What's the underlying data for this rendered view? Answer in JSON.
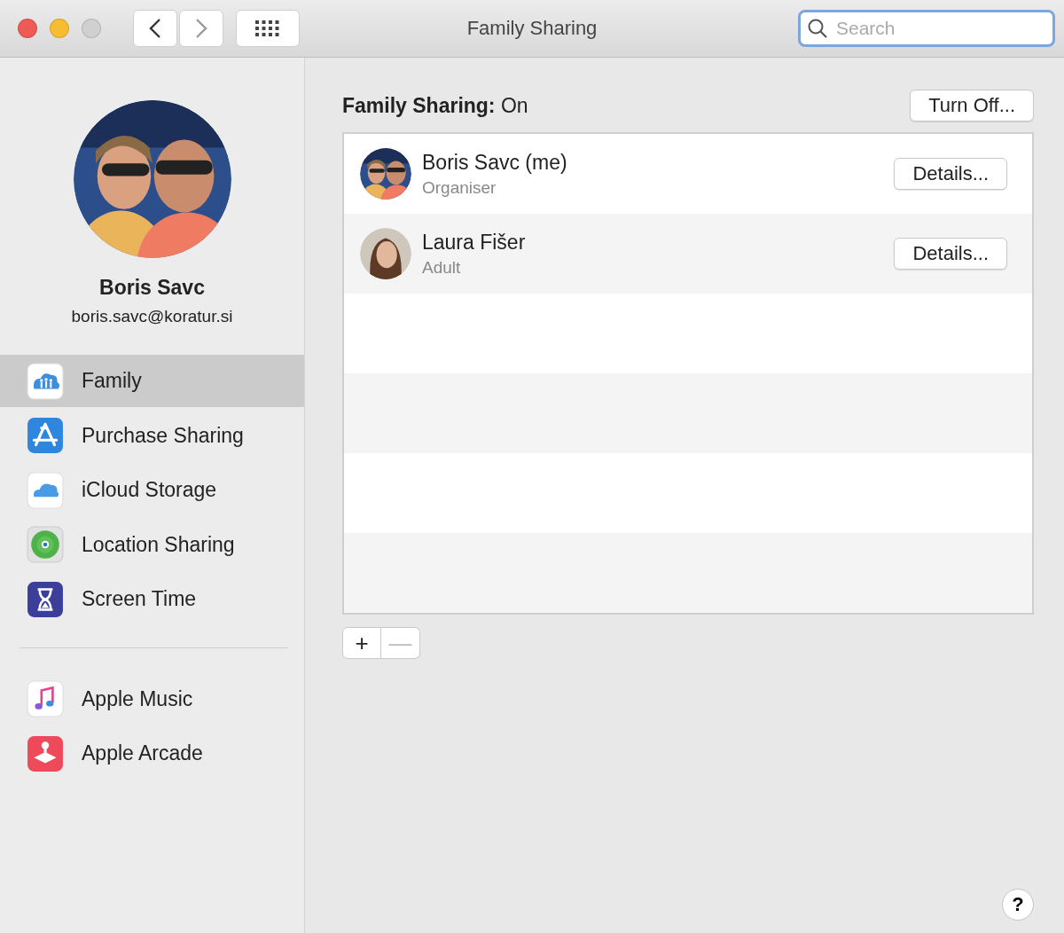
{
  "window": {
    "title": "Family Sharing",
    "controls": [
      {
        "kind": "close",
        "disabled": false
      },
      {
        "kind": "minimize",
        "disabled": false
      },
      {
        "kind": "zoom",
        "disabled": true
      }
    ]
  },
  "search": {
    "placeholder": "Search"
  },
  "account": {
    "name": "Boris Savc",
    "email": "boris.savc@koratur.si"
  },
  "sidebar": {
    "items": [
      {
        "kind": "family",
        "label": "Family",
        "selected": true
      },
      {
        "kind": "store",
        "label": "Purchase Sharing",
        "selected": false
      },
      {
        "kind": "cloud",
        "label": "iCloud Storage",
        "selected": false
      },
      {
        "kind": "location",
        "label": "Location Sharing",
        "selected": false
      },
      {
        "kind": "hourglass",
        "label": "Screen Time",
        "selected": false
      }
    ],
    "extra_items": [
      {
        "kind": "music",
        "label": "Apple Music",
        "selected": false
      },
      {
        "kind": "arcade",
        "label": "Apple Arcade",
        "selected": false
      }
    ]
  },
  "status": {
    "text": "**Family Sharing:** On",
    "button": "Turn Off..."
  },
  "members": [
    {
      "name": "Boris Savc (me)",
      "role": "Organiser",
      "button": "Details..."
    },
    {
      "name": "Laura Fišer",
      "role": "Adult",
      "button": "Details..."
    }
  ],
  "list_buttons": [
    {
      "label": "+",
      "disabled": false
    },
    {
      "label": "—",
      "disabled": true
    }
  ],
  "help": "?"
}
